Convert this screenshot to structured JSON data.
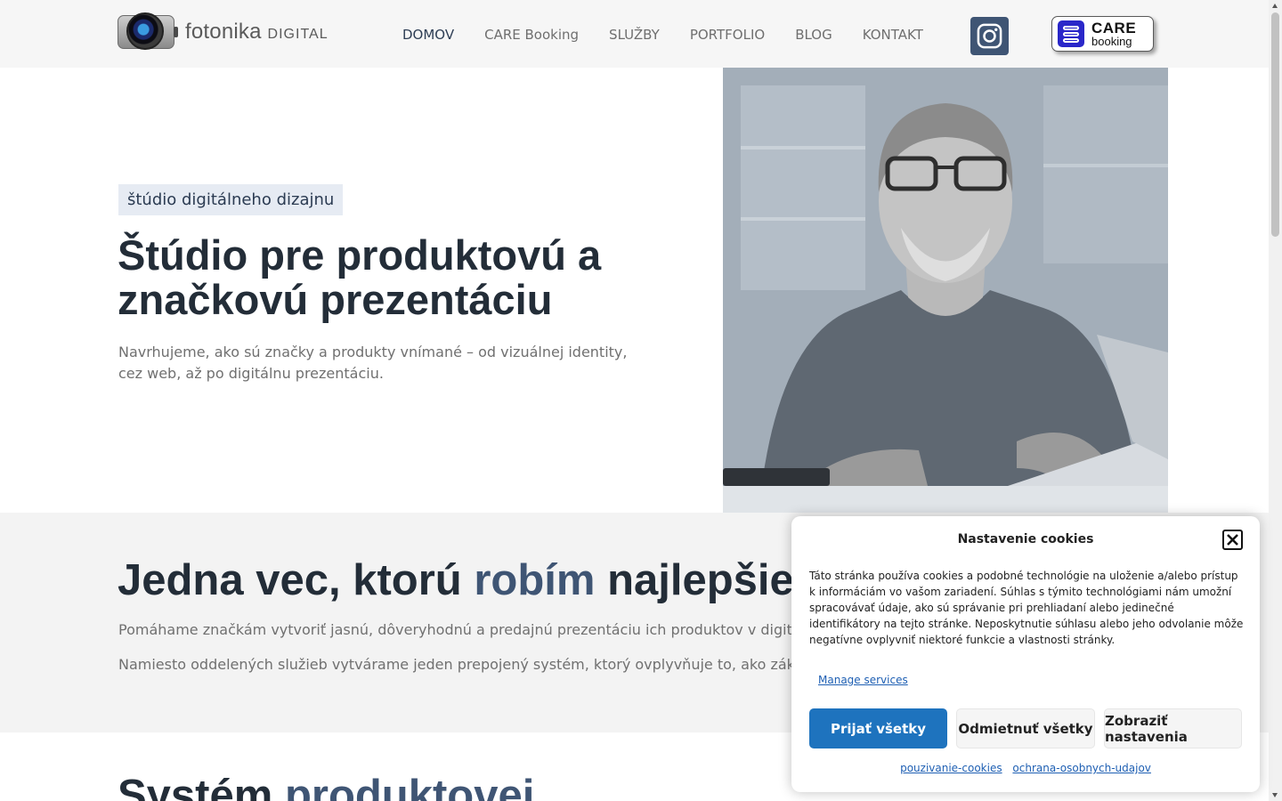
{
  "header": {
    "logo_text": "fotonika",
    "logo_suffix": "DIGITAL",
    "nav": [
      {
        "label": "DOMOV",
        "active": true
      },
      {
        "label": "CARE Booking"
      },
      {
        "label": "SLUŽBY"
      },
      {
        "label": "PORTFOLIO"
      },
      {
        "label": "BLOG"
      },
      {
        "label": "KONTAKT"
      }
    ],
    "social_icon": "instagram-icon",
    "care_button": {
      "line1": "CARE",
      "line2": "booking"
    }
  },
  "hero": {
    "badge": "štúdio digitálneho dizajnu",
    "title": "Štúdio pre produktovú a značkovú prezentáciu",
    "subtitle": "Navrhujeme, ako sú značky a produkty vnímané – od vizuálnej identity, cez web, až po digitálnu prezentáciu."
  },
  "section2": {
    "title_part1": "Jedna vec, ktorú ",
    "title_accent": "robím",
    "title_part2": " najlepšie",
    "p1": "Pomáhame značkám vytvoriť jasnú, dôveryhodnú a predajnú prezentáciu ich produktov v digitálnom",
    "p2": "Namiesto oddelených služieb vytvárame jeden prepojený systém, ktorý ovplyvňuje to, ako zákazník"
  },
  "section3": {
    "title_part1": "Systém ",
    "title_accent": "produktovej"
  },
  "cookie": {
    "title": "Nastavenie cookies",
    "body": "Táto stránka používa cookies a podobné technológie na uloženie a/alebo prístup k informáciám vo vašom zariadení. Súhlas s týmito technológiami nám umožní spracovávať údaje, ako sú správanie pri prehliadaní alebo jedinečné identifikátory na tejto stránke. Neposkytnutie súhlasu alebo jeho odvolanie môže negatívne ovplyvniť niektoré funkcie a vlastnosti stránky.",
    "manage": "Manage services",
    "accept": "Prijať všetky",
    "deny": "Odmietnuť všetky",
    "settings": "Zobraziť nastavenia",
    "link1": "pouzivanie-cookies",
    "link2": "ochrana-osobnych-udajov"
  },
  "colors": {
    "accent": "#3f5574",
    "primary_button": "#1e73be"
  }
}
